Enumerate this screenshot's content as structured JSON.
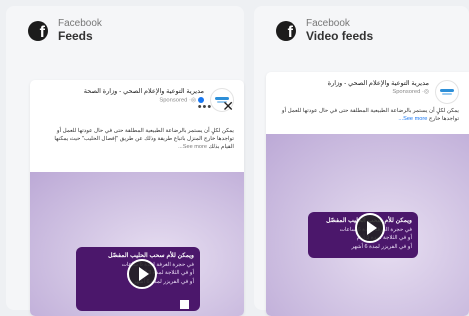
{
  "panels": [
    {
      "network": "Facebook",
      "placement": "Feeds",
      "icon": "facebook-icon",
      "ad": {
        "page_name": "مديرية التوعية والإعلام الصحي - وزارة الصحة",
        "sponsored": "Sponsored",
        "body": "يمكن لكلٍ أن يستمر بالرضاعة الطبيعية المطلقة حتى في حال عودتها للعمل أو تواجدها خارج المنزل باتباع طريقة وذلك عن طريق \"إفصال الحليب\" حيث يمكنها القيام بذلك",
        "see_more": "See more...",
        "banner_title": "ويمكن للأم سحب الحليب المفصّل",
        "banner_lines": [
          "في حجرة الغرفة لمدة 6 ساعات",
          "أو في الثلاجة لمدة 3 أيام",
          "أو في الفريزر لمدة 6 أشهر"
        ]
      }
    },
    {
      "network": "Facebook",
      "placement": "Video feeds",
      "icon": "facebook-icon",
      "ad": {
        "page_name": "مديرية التوعية والإعلام الصحي - وزارة",
        "sponsored": "Sponsored",
        "body": "يمكن لكلٍ أن يستمر بالرضاعة الطبيعية المطلقة حتى في حال عودتها للعمل أو تواجدها خارج",
        "see_more": "See more...",
        "banner_title": "ويمكن للأم سحب الحليب المفصّل",
        "banner_lines": [
          "في حجرة الغرفة لمدة 6 ساعات",
          "أو في الثلاجة لمدة 3 أيام",
          "أو في الفريزر لمدة 6 أشهر"
        ]
      }
    }
  ],
  "controls": {
    "more": "•••",
    "close": "✕"
  },
  "colors": {
    "banner": "#4b176b",
    "media_bg": "#cfc1e2",
    "link": "#1877f2"
  }
}
